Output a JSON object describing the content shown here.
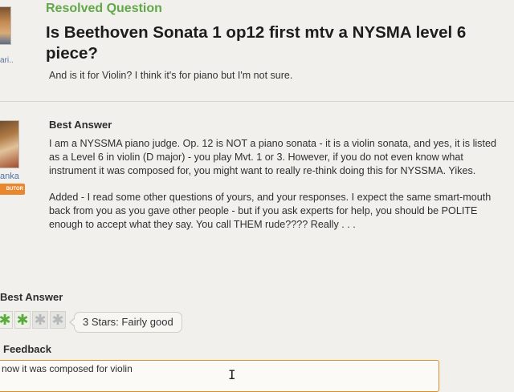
{
  "sidebar": {
    "asker_name_fragment": "ari..",
    "answerer_name_fragment": "anka",
    "answerer_badge": "BUTOR"
  },
  "question": {
    "status": "Resolved Question",
    "title": "Is Beethoven Sonata 1 op12 first mtv a NYSMA level 6 piece?",
    "details": "And is it for Violin? I think it's for piano but I'm not sure."
  },
  "best_answer": {
    "heading": "Best Answer",
    "paragraphs": [
      "I am a NYSSMA piano judge. Op. 12 is NOT a piano sonata - it is a violin sonata, and yes, it is listed as a Level 6 in violin (D major) - you play Mvt. 1 or 3. However, if you do not even know what instrument it was composed for, you might want to really re-think doing this for NYSSMA. Yikes.",
      "Added - I read some other questions of yours, and your responses. I expect the same smart-mouth back from you as you gave other people - but if you ask experts for help, you should be POLITE enough to accept what they say. You call THEM rude???? Really . . ."
    ]
  },
  "rating": {
    "heading": "Best Answer",
    "stars_filled": 3,
    "stars_total": 5,
    "stars_visible_in_crop": 4,
    "label": "3 Stars: Fairly good",
    "star_on_color": "#5aab3e",
    "star_off_color": "#b5b7b9"
  },
  "feedback": {
    "heading": "Feedback",
    "value": "now it was composed for violin",
    "border_color": "#d8902c"
  },
  "colors": {
    "status_green": "#62a84a",
    "badge_orange": "#e9872e",
    "link_blue": "#4e6ea8"
  }
}
